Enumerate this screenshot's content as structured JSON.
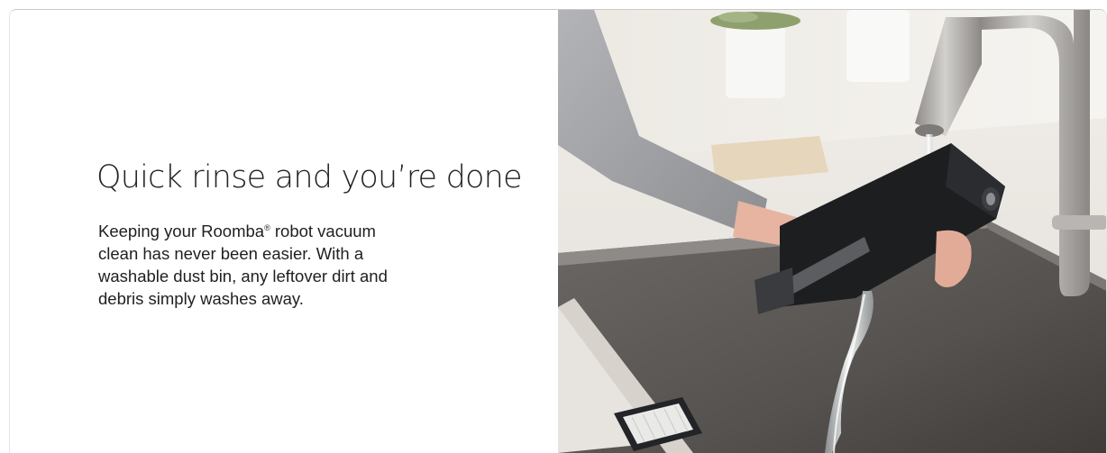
{
  "feature": {
    "heading": "Quick rinse and you’re done",
    "body_prefix": "Keeping your Roomba",
    "body_reg_mark": "®",
    "body_suffix": " robot vacuum clean has never been easier. With a washable dust bin, any leftover dirt and debris simply washes away."
  },
  "photo": {
    "subject": "hand rinsing a robot vacuum dust bin under a kitchen faucet",
    "icon": "product-photo"
  },
  "colors": {
    "background": "#ffffff",
    "heading_text": "#222222",
    "body_text": "#1f1f1f",
    "countertop": "#e9e6e1",
    "sink": "#5b5856",
    "faucet": "#a9a6a3",
    "bin": "#1d1e20",
    "sleeve": "#9a9b9e"
  }
}
